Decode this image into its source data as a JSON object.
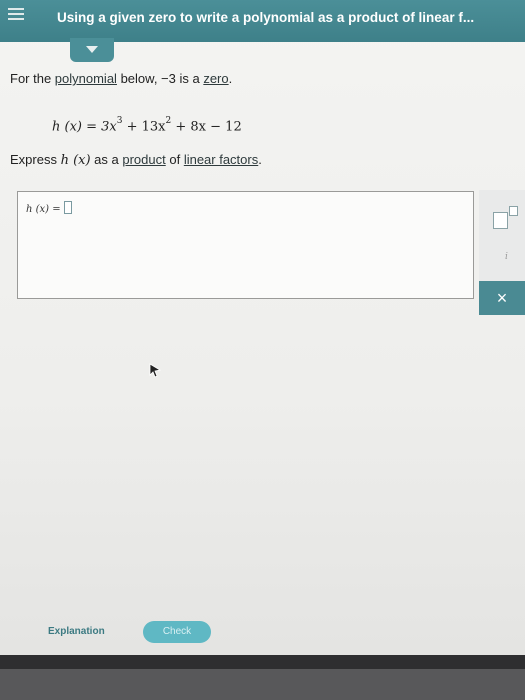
{
  "header": {
    "title": "Using a given zero to write a polynomial as a product of linear f..."
  },
  "question": {
    "intro_prefix": "For the ",
    "intro_link1": "polynomial",
    "intro_middle": " below, −3 is a ",
    "intro_link2": "zero",
    "intro_suffix": ".",
    "equation_lhs": "h (x) = 3x",
    "equation_exp1": "3",
    "equation_mid": " + 13x",
    "equation_exp2": "2",
    "equation_rhs": " + 8x − 12",
    "instruction_prefix": "Express ",
    "instruction_func": "h (x)",
    "instruction_middle": " as a ",
    "instruction_link1": "product",
    "instruction_of": " of ",
    "instruction_link2": "linear factors",
    "instruction_suffix": "."
  },
  "answer": {
    "label": "h (x) ="
  },
  "side_panel": {
    "info_label": "i",
    "close_label": "×"
  },
  "footer": {
    "explanation_label": "Explanation",
    "check_label": "Check"
  },
  "colors": {
    "header_teal": "#4b8f98",
    "check_button": "#5fb8c4"
  }
}
